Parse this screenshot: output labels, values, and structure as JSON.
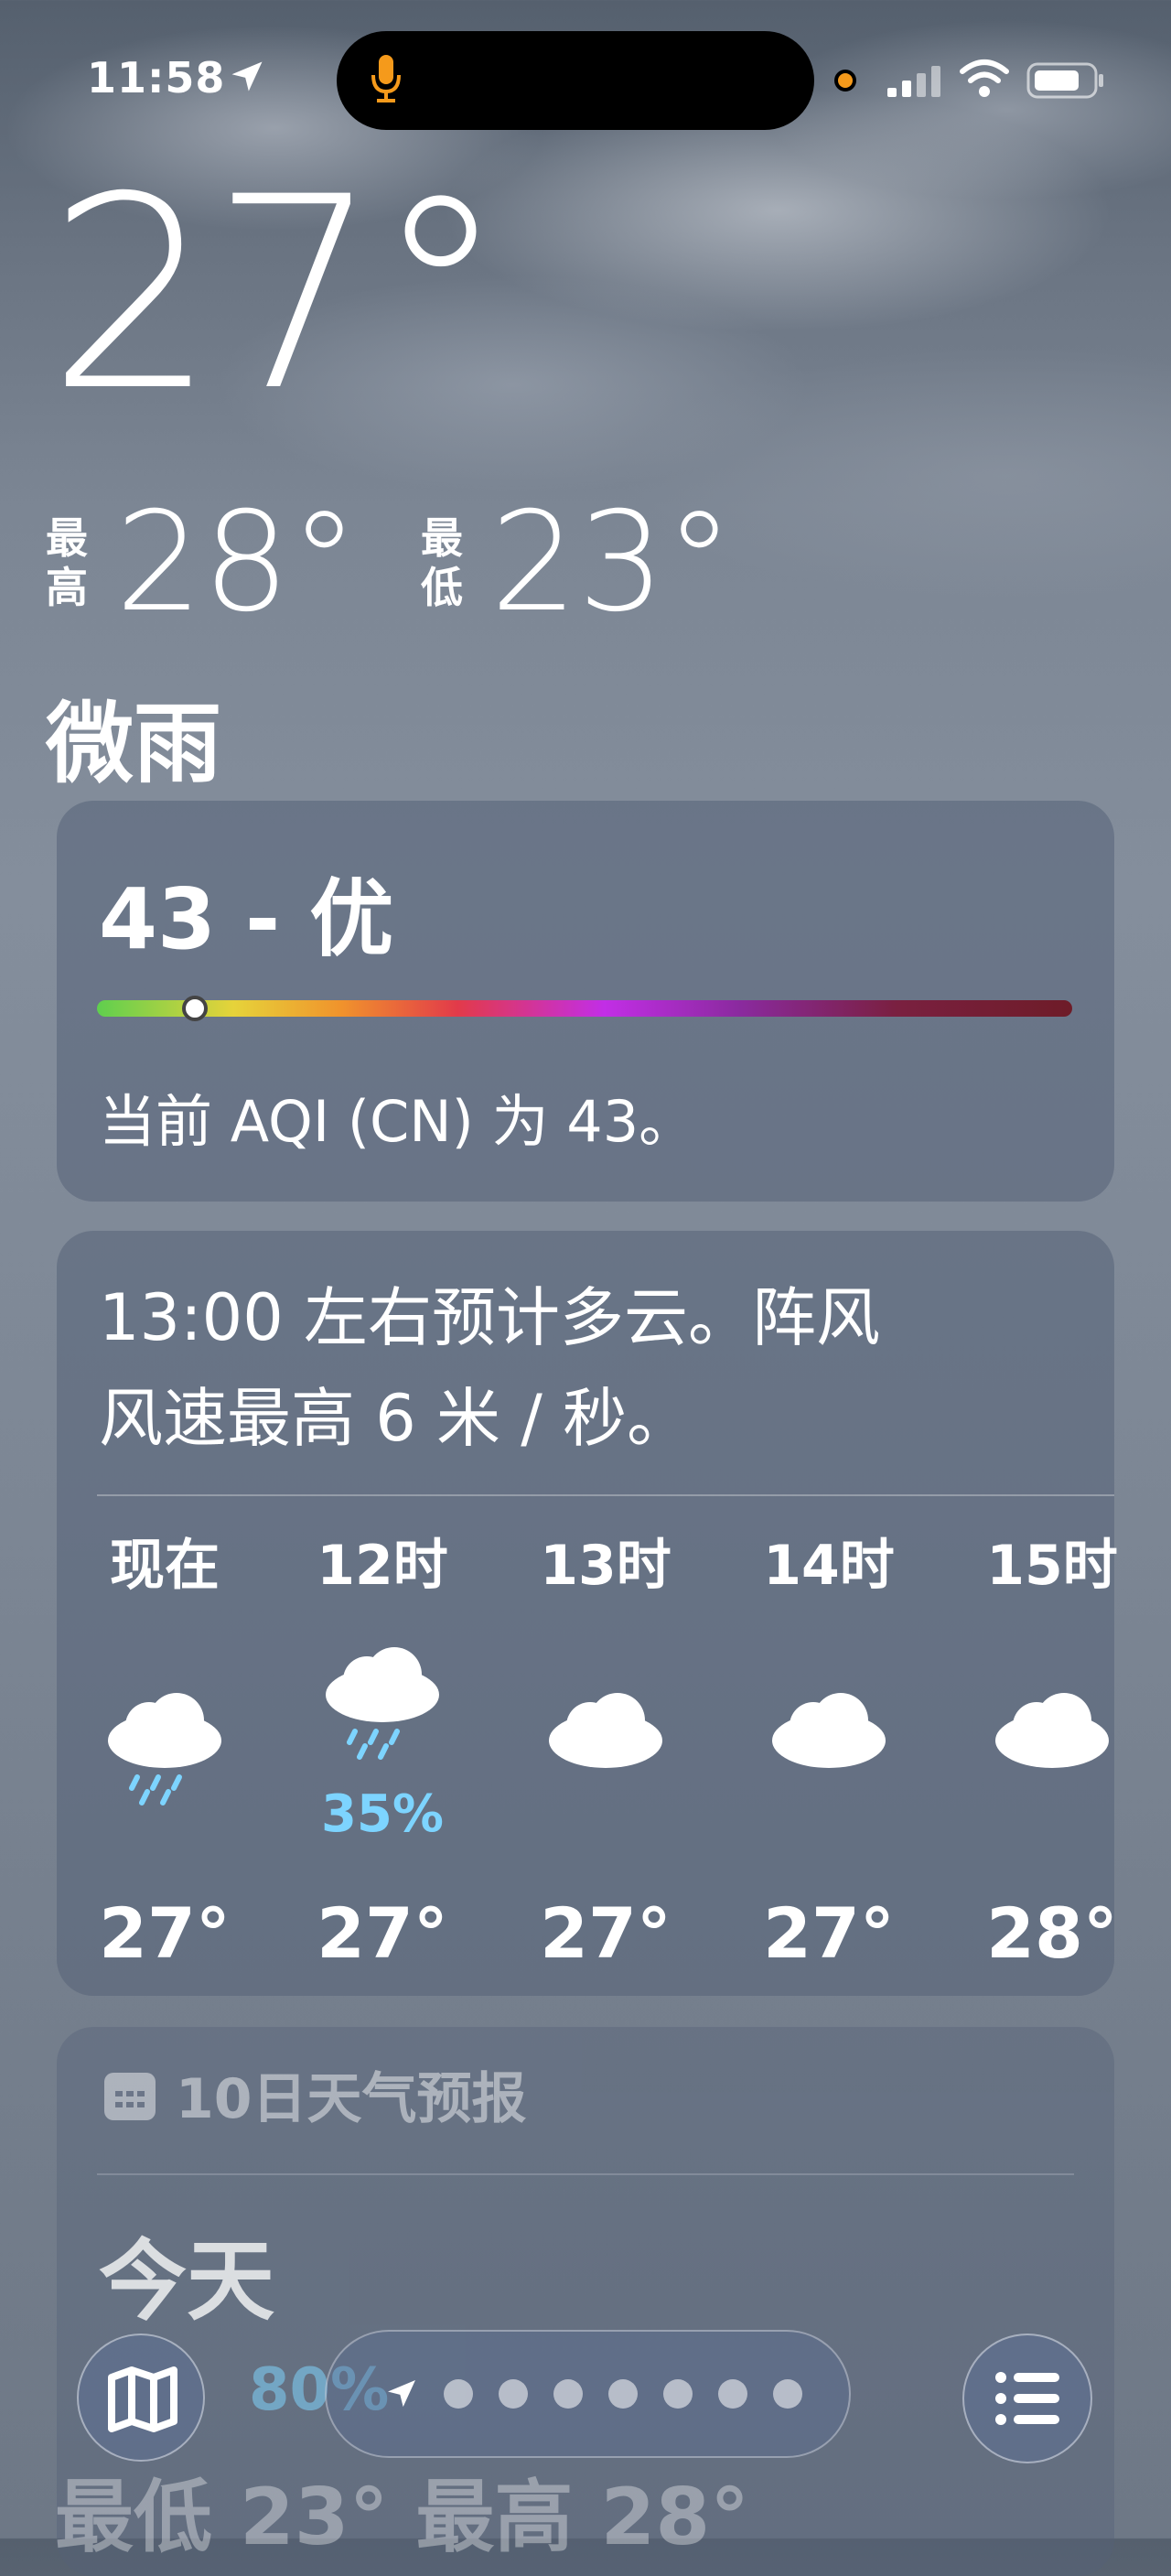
{
  "status_bar": {
    "time": "11:58"
  },
  "current": {
    "temperature": "27°",
    "high_label": [
      "最",
      "高"
    ],
    "high": "28°",
    "low_label": [
      "最",
      "低"
    ],
    "low": "23°",
    "condition": "微雨"
  },
  "aqi": {
    "value_text": "43 - 优",
    "value": 43,
    "indicator_position": 0.1,
    "description": "当前 AQI (CN) 为 43。"
  },
  "hourly": {
    "summary_line1": "13:00 左右预计多云。阵风",
    "summary_line2": "风速最高 6 米 / 秒。",
    "hours": [
      {
        "label": "现在",
        "icon": "rain-cloud-icon",
        "precip": "",
        "temp": "27°"
      },
      {
        "label": "12时",
        "icon": "rain-cloud-icon",
        "precip": "35%",
        "temp": "27°"
      },
      {
        "label": "13时",
        "icon": "cloud-icon",
        "precip": "",
        "temp": "27°"
      },
      {
        "label": "14时",
        "icon": "cloud-icon",
        "precip": "",
        "temp": "27°"
      },
      {
        "label": "15时",
        "icon": "cloud-icon",
        "precip": "",
        "temp": "28°"
      }
    ]
  },
  "daily": {
    "header": "10日天气预报",
    "today_label": "今天",
    "today_precip": "80%",
    "today_lowhigh": "最低 23°  最高 28°"
  },
  "bottom_bar": {
    "map_icon": "map-icon",
    "location_icon": "location-arrow-icon",
    "page_count": 7,
    "list_icon": "list-icon"
  },
  "colors": {
    "precip_blue": "#7dd4ff",
    "recording_dot": "#f59a1b"
  }
}
